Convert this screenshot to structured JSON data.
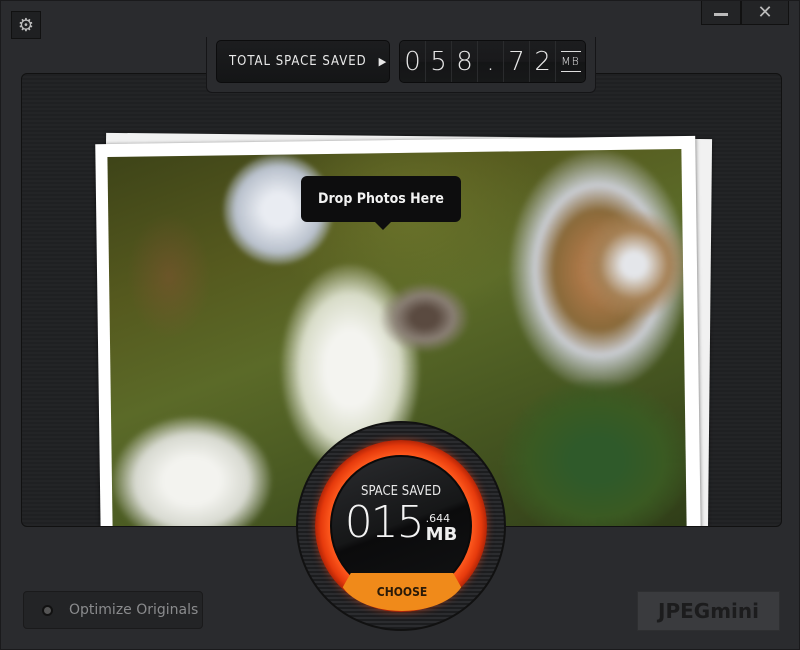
{
  "window": {
    "settings_icon": "gear-icon",
    "minimize_icon": "minimize-icon",
    "close_icon": "close-icon",
    "close_glyph": "✕",
    "settings_glyph": "⚙"
  },
  "counter": {
    "total_label": "TOTAL SPACE SAVED",
    "arrow_glyph": "▶",
    "digits": [
      "0",
      "5",
      "8",
      ".",
      "7",
      "2"
    ],
    "unit": "MB"
  },
  "drop_area": {
    "tooltip": "Drop Photos Here"
  },
  "gauge": {
    "label": "SPACE SAVED",
    "value": "015",
    "decimal": ".644",
    "unit": "MB",
    "choose_label": "CHOOSE",
    "ring_color": "#ff4a14",
    "choose_color": "#f08a1a"
  },
  "footer": {
    "optimize_label": "Optimize Originals",
    "optimize_checked": false,
    "logo_text": "JPEGmini"
  }
}
